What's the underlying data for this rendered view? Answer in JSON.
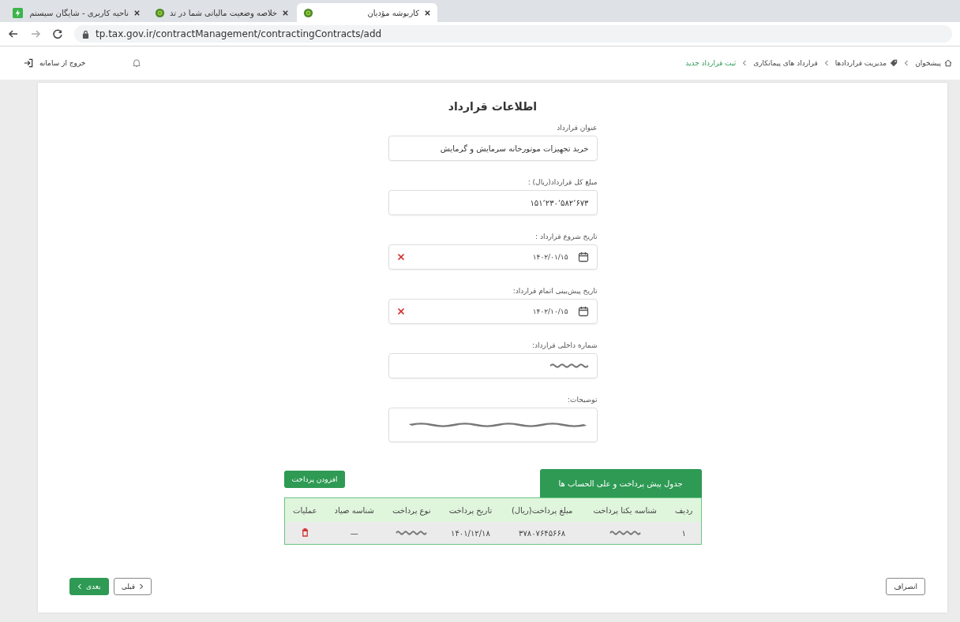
{
  "browser": {
    "tabs": [
      {
        "title": "کاربوشه مؤدیان",
        "selected": true
      },
      {
        "title": "خلاصه وضعیت مالیاتی شما در تد",
        "selected": false
      },
      {
        "title": "ناحیه کاربری - شایگان سیستم",
        "selected": false
      }
    ],
    "url": "tp.tax.gov.ir/contractManagement/contractingContracts/add"
  },
  "header": {
    "logout": "خروج از سامانه",
    "breadcrumb": [
      {
        "label": "پیشخوان",
        "current": false
      },
      {
        "label": "مدیریت قراردادها",
        "current": false
      },
      {
        "label": "قرارداد های پیمانکاری",
        "current": false
      },
      {
        "label": "ثبت قرارداد جدید",
        "current": true
      }
    ]
  },
  "form": {
    "title": "اطلاعات قرارداد",
    "fields": [
      {
        "kind": "text",
        "label": "عنوان قرارداد",
        "value": "خرید تجهیزات موتورخانه سرمایش و گرمایش"
      },
      {
        "kind": "text",
        "label": "مبلغ کل قرارداد(ریال) :",
        "value": "۱۵۱٬۲۳۰٬۵۸۲٬۶۷۳"
      },
      {
        "kind": "date",
        "label": "تاریخ شروع قرارداد :",
        "value": "۱۴۰۲/۰۱/۱۵"
      },
      {
        "kind": "date",
        "label": "تاریخ پیش‌بینی اتمام قرارداد:",
        "value": "۱۴۰۲/۱۰/۱۵"
      },
      {
        "kind": "text",
        "label": "شماره داخلی قرارداد:"
      },
      {
        "kind": "textarea",
        "label": "توضیحات:"
      }
    ]
  },
  "payments": {
    "tab": "جدول پیش پرداخت و علی الحساب ها",
    "add_button": "افزودن پرداخت",
    "columns": [
      "ردیف",
      "شناسه یکتا پرداخت",
      "مبلغ پرداخت(ریال)",
      "تاریخ پرداخت",
      "نوع پرداخت",
      "شناسه صیاد",
      "عملیات"
    ],
    "rows": [
      {
        "cells": [
          {
            "kind": "text",
            "text": "۱"
          },
          {
            "kind": "redacted"
          },
          {
            "kind": "text",
            "text": "۳۷۸۰۷۶۴۵۶۶۸"
          },
          {
            "kind": "text",
            "text": "۱۴۰۱/۱۲/۱۸"
          },
          {
            "kind": "redacted"
          },
          {
            "kind": "text",
            "text": "—"
          },
          {
            "kind": "delete"
          }
        ]
      }
    ]
  },
  "footer": {
    "cancel": "انصراف",
    "previous": "قبلی",
    "next": "بعدی"
  }
}
